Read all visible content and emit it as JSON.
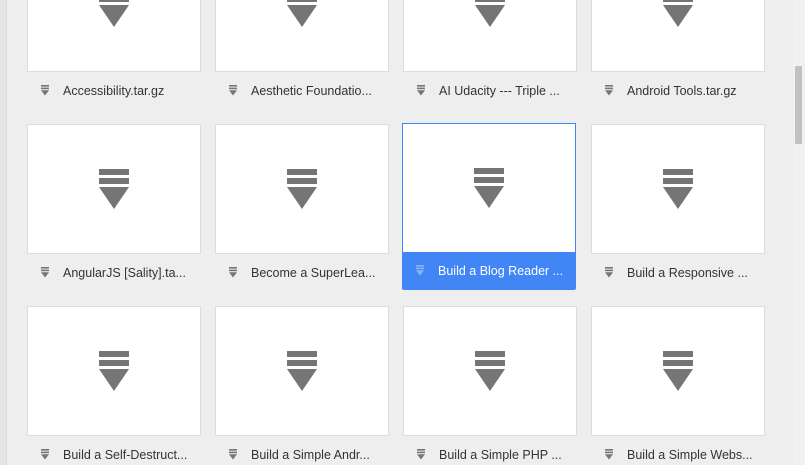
{
  "files": [
    {
      "name": "Accessibility.tar.gz",
      "selected": false
    },
    {
      "name": "Aesthetic Foundatio...",
      "selected": false
    },
    {
      "name": "AI Udacity --- Triple ...",
      "selected": false
    },
    {
      "name": "Android Tools.tar.gz",
      "selected": false
    },
    {
      "name": "AngularJS [Sality].ta...",
      "selected": false
    },
    {
      "name": "Become a SuperLea...",
      "selected": false
    },
    {
      "name": "Build a Blog Reader ...",
      "selected": true
    },
    {
      "name": "Build a Responsive ...",
      "selected": false
    },
    {
      "name": "Build a Self-Destruct...",
      "selected": false
    },
    {
      "name": "Build a Simple Andr...",
      "selected": false
    },
    {
      "name": "Build a Simple PHP ...",
      "selected": false
    },
    {
      "name": "Build a Simple Webs...",
      "selected": false
    }
  ],
  "icons": {
    "thumbnail": "download-icon",
    "label": "download-icon"
  },
  "colors": {
    "selection": "#4285f4",
    "icon": "#757575"
  }
}
